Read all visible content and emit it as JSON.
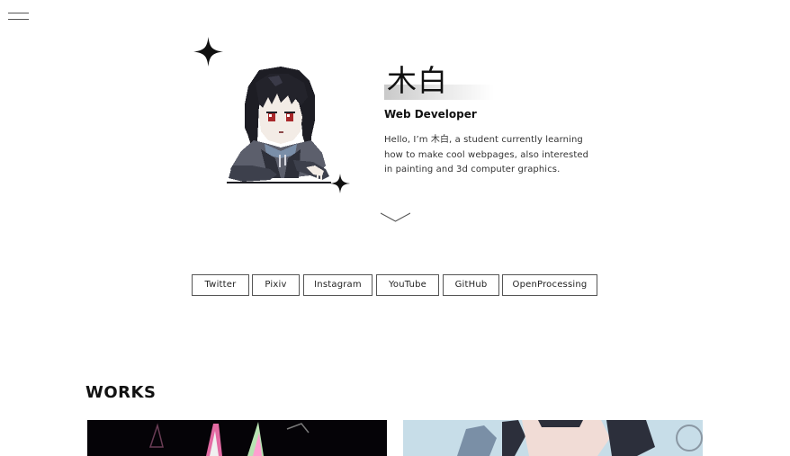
{
  "profile": {
    "name": "木白",
    "role": "Web Developer",
    "bio": "Hello, I’m 木白, a student currently learning how to make cool webpages, also interested in painting and 3d computer graphics."
  },
  "links": [
    "Twitter",
    "Pixiv",
    "Instagram",
    "YouTube",
    "GitHub",
    "OpenProcessing"
  ],
  "works": {
    "title": "WORKS"
  },
  "icons": {
    "menu": "menu-icon",
    "scroll": "chevron-down-icon",
    "sparkle": "sparkle-icon",
    "avatar": "pixel-art-avatar"
  },
  "colors": {
    "text": "#111111",
    "border": "#555555",
    "highlight": "#cfcfcf"
  }
}
